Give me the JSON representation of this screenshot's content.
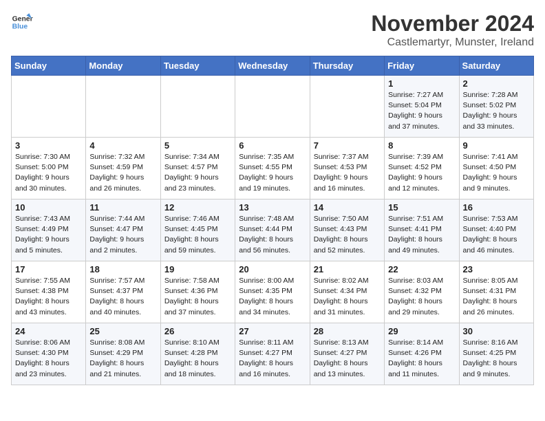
{
  "logo": {
    "line1": "General",
    "line2": "Blue"
  },
  "title": "November 2024",
  "location": "Castlemartyr, Munster, Ireland",
  "days_of_week": [
    "Sunday",
    "Monday",
    "Tuesday",
    "Wednesday",
    "Thursday",
    "Friday",
    "Saturday"
  ],
  "weeks": [
    [
      {
        "day": "",
        "info": ""
      },
      {
        "day": "",
        "info": ""
      },
      {
        "day": "",
        "info": ""
      },
      {
        "day": "",
        "info": ""
      },
      {
        "day": "",
        "info": ""
      },
      {
        "day": "1",
        "info": "Sunrise: 7:27 AM\nSunset: 5:04 PM\nDaylight: 9 hours\nand 37 minutes."
      },
      {
        "day": "2",
        "info": "Sunrise: 7:28 AM\nSunset: 5:02 PM\nDaylight: 9 hours\nand 33 minutes."
      }
    ],
    [
      {
        "day": "3",
        "info": "Sunrise: 7:30 AM\nSunset: 5:00 PM\nDaylight: 9 hours\nand 30 minutes."
      },
      {
        "day": "4",
        "info": "Sunrise: 7:32 AM\nSunset: 4:59 PM\nDaylight: 9 hours\nand 26 minutes."
      },
      {
        "day": "5",
        "info": "Sunrise: 7:34 AM\nSunset: 4:57 PM\nDaylight: 9 hours\nand 23 minutes."
      },
      {
        "day": "6",
        "info": "Sunrise: 7:35 AM\nSunset: 4:55 PM\nDaylight: 9 hours\nand 19 minutes."
      },
      {
        "day": "7",
        "info": "Sunrise: 7:37 AM\nSunset: 4:53 PM\nDaylight: 9 hours\nand 16 minutes."
      },
      {
        "day": "8",
        "info": "Sunrise: 7:39 AM\nSunset: 4:52 PM\nDaylight: 9 hours\nand 12 minutes."
      },
      {
        "day": "9",
        "info": "Sunrise: 7:41 AM\nSunset: 4:50 PM\nDaylight: 9 hours\nand 9 minutes."
      }
    ],
    [
      {
        "day": "10",
        "info": "Sunrise: 7:43 AM\nSunset: 4:49 PM\nDaylight: 9 hours\nand 5 minutes."
      },
      {
        "day": "11",
        "info": "Sunrise: 7:44 AM\nSunset: 4:47 PM\nDaylight: 9 hours\nand 2 minutes."
      },
      {
        "day": "12",
        "info": "Sunrise: 7:46 AM\nSunset: 4:45 PM\nDaylight: 8 hours\nand 59 minutes."
      },
      {
        "day": "13",
        "info": "Sunrise: 7:48 AM\nSunset: 4:44 PM\nDaylight: 8 hours\nand 56 minutes."
      },
      {
        "day": "14",
        "info": "Sunrise: 7:50 AM\nSunset: 4:43 PM\nDaylight: 8 hours\nand 52 minutes."
      },
      {
        "day": "15",
        "info": "Sunrise: 7:51 AM\nSunset: 4:41 PM\nDaylight: 8 hours\nand 49 minutes."
      },
      {
        "day": "16",
        "info": "Sunrise: 7:53 AM\nSunset: 4:40 PM\nDaylight: 8 hours\nand 46 minutes."
      }
    ],
    [
      {
        "day": "17",
        "info": "Sunrise: 7:55 AM\nSunset: 4:38 PM\nDaylight: 8 hours\nand 43 minutes."
      },
      {
        "day": "18",
        "info": "Sunrise: 7:57 AM\nSunset: 4:37 PM\nDaylight: 8 hours\nand 40 minutes."
      },
      {
        "day": "19",
        "info": "Sunrise: 7:58 AM\nSunset: 4:36 PM\nDaylight: 8 hours\nand 37 minutes."
      },
      {
        "day": "20",
        "info": "Sunrise: 8:00 AM\nSunset: 4:35 PM\nDaylight: 8 hours\nand 34 minutes."
      },
      {
        "day": "21",
        "info": "Sunrise: 8:02 AM\nSunset: 4:34 PM\nDaylight: 8 hours\nand 31 minutes."
      },
      {
        "day": "22",
        "info": "Sunrise: 8:03 AM\nSunset: 4:32 PM\nDaylight: 8 hours\nand 29 minutes."
      },
      {
        "day": "23",
        "info": "Sunrise: 8:05 AM\nSunset: 4:31 PM\nDaylight: 8 hours\nand 26 minutes."
      }
    ],
    [
      {
        "day": "24",
        "info": "Sunrise: 8:06 AM\nSunset: 4:30 PM\nDaylight: 8 hours\nand 23 minutes."
      },
      {
        "day": "25",
        "info": "Sunrise: 8:08 AM\nSunset: 4:29 PM\nDaylight: 8 hours\nand 21 minutes."
      },
      {
        "day": "26",
        "info": "Sunrise: 8:10 AM\nSunset: 4:28 PM\nDaylight: 8 hours\nand 18 minutes."
      },
      {
        "day": "27",
        "info": "Sunrise: 8:11 AM\nSunset: 4:27 PM\nDaylight: 8 hours\nand 16 minutes."
      },
      {
        "day": "28",
        "info": "Sunrise: 8:13 AM\nSunset: 4:27 PM\nDaylight: 8 hours\nand 13 minutes."
      },
      {
        "day": "29",
        "info": "Sunrise: 8:14 AM\nSunset: 4:26 PM\nDaylight: 8 hours\nand 11 minutes."
      },
      {
        "day": "30",
        "info": "Sunrise: 8:16 AM\nSunset: 4:25 PM\nDaylight: 8 hours\nand 9 minutes."
      }
    ]
  ]
}
